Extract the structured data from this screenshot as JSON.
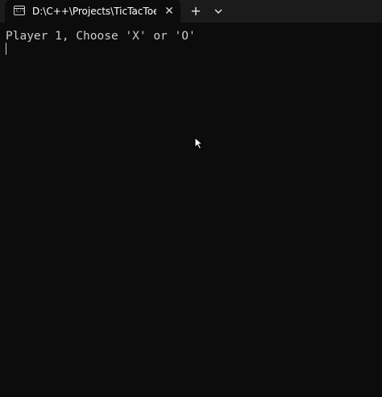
{
  "tab": {
    "title": "D:\\C++\\Projects\\TicTacToe.ex",
    "icon": "terminal-icon",
    "close_glyph": "✕"
  },
  "toolbar": {
    "new_tab_glyph": "+",
    "dropdown_icon": "chevron-down-icon"
  },
  "terminal": {
    "lines": [
      "Player 1, Choose 'X' or 'O'"
    ],
    "background": "#0c0c0c",
    "foreground": "#cccccc"
  }
}
